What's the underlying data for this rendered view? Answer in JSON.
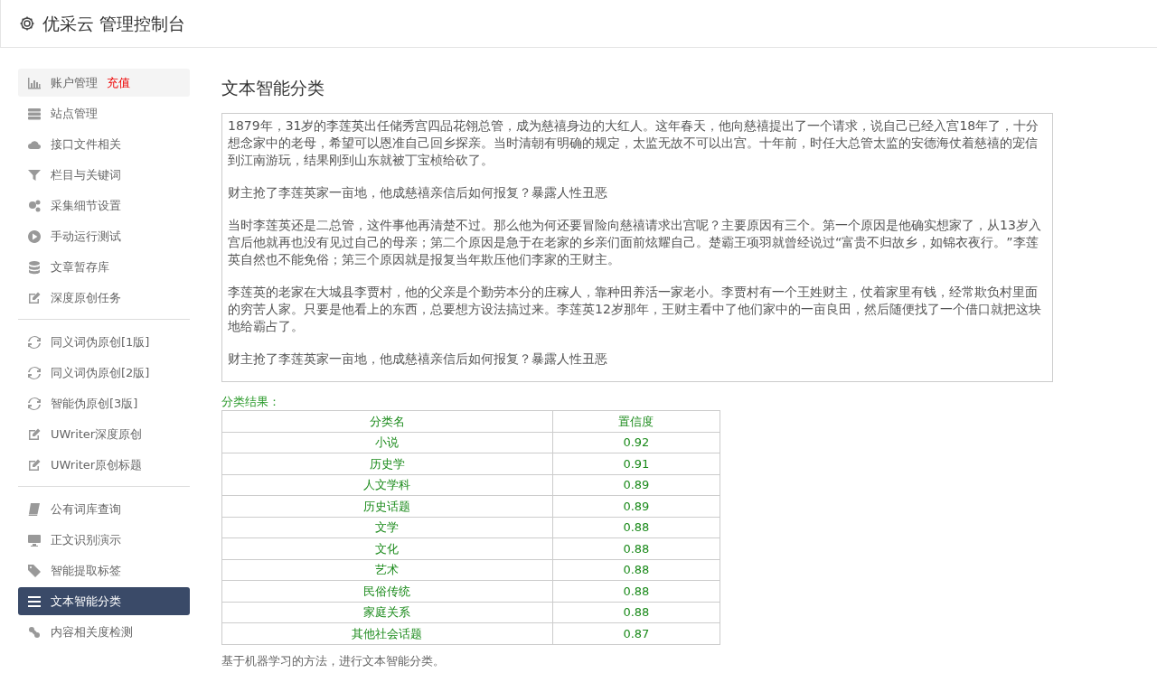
{
  "header": {
    "title": "优采云 管理控制台"
  },
  "sidebar": {
    "groups": [
      [
        {
          "label": "账户管理",
          "badge": "充值",
          "selected": false
        },
        {
          "label": "站点管理",
          "selected": false
        },
        {
          "label": "接口文件相关",
          "selected": false
        },
        {
          "label": "栏目与关键词",
          "selected": false
        },
        {
          "label": "采集细节设置",
          "selected": false
        },
        {
          "label": "手动运行测试",
          "selected": false
        },
        {
          "label": "文章暂存库",
          "selected": false
        },
        {
          "label": "深度原创任务",
          "selected": false
        }
      ],
      [
        {
          "label": "同义词伪原创[1版]",
          "selected": false
        },
        {
          "label": "同义词伪原创[2版]",
          "selected": false
        },
        {
          "label": "智能伪原创[3版]",
          "selected": false
        },
        {
          "label": "UWriter深度原创",
          "selected": false
        },
        {
          "label": "UWriter原创标题",
          "selected": false
        }
      ],
      [
        {
          "label": "公有词库查询",
          "selected": false
        },
        {
          "label": "正文识别演示",
          "selected": false
        },
        {
          "label": "智能提取标签",
          "selected": false
        },
        {
          "label": "文本智能分类",
          "selected": true
        },
        {
          "label": "内容相关度检测",
          "selected": false
        }
      ]
    ]
  },
  "main": {
    "title": "文本智能分类",
    "paragraphs": [
      "1879年，31岁的李莲英出任储秀宫四品花翎总管，成为慈禧身边的大红人。这年春天，他向慈禧提出了一个请求，说自己已经入宫18年了，十分想念家中的老母，希望可以恩准自己回乡探亲。当时清朝有明确的规定，太监无故不可以出宫。十年前，时任大总管太监的安德海仗着慈禧的宠信到江南游玩，结果刚到山东就被丁宝桢给砍了。",
      "财主抢了李莲英家一亩地，他成慈禧亲信后如何报复？暴露人性丑恶",
      "当时李莲英还是二总管，这件事他再清楚不过。那么他为何还要冒险向慈禧请求出宫呢？主要原因有三个。第一个原因是他确实想家了，从13岁入宫后他就再也没有见过自己的母亲；第二个原因是急于在老家的乡亲们面前炫耀自己。楚霸王项羽就曾经说过“富贵不归故乡，如锦衣夜行。”李莲英自然也不能免俗；第三个原因就是报复当年欺压他们李家的王财主。",
      "李莲英的老家在大城县李贾村，他的父亲是个勤劳本分的庄稼人，靠种田养活一家老小。李贾村有一个王姓财主，仗着家里有钱，经常欺负村里面的穷苦人家。只要是他看上的东西，总要想方设法搞过来。李莲英12岁那年，王财主看中了他们家中的一亩良田，然后随便找了一个借口就把这块地给霸占了。",
      "财主抢了李莲英家一亩地，他成慈禧亲信后如何报复？暴露人性丑恶"
    ],
    "result_label": "分类结果：",
    "table": {
      "columns": [
        "分类名",
        "置信度"
      ],
      "rows": [
        [
          "小说",
          "0.92"
        ],
        [
          "历史学",
          "0.91"
        ],
        [
          "人文学科",
          "0.89"
        ],
        [
          "历史话题",
          "0.89"
        ],
        [
          "文学",
          "0.88"
        ],
        [
          "文化",
          "0.88"
        ],
        [
          "艺术",
          "0.88"
        ],
        [
          "民俗传统",
          "0.88"
        ],
        [
          "家庭关系",
          "0.88"
        ],
        [
          "其他社会话题",
          "0.87"
        ]
      ]
    },
    "footnote": "基于机器学习的方法，进行文本智能分类。"
  }
}
